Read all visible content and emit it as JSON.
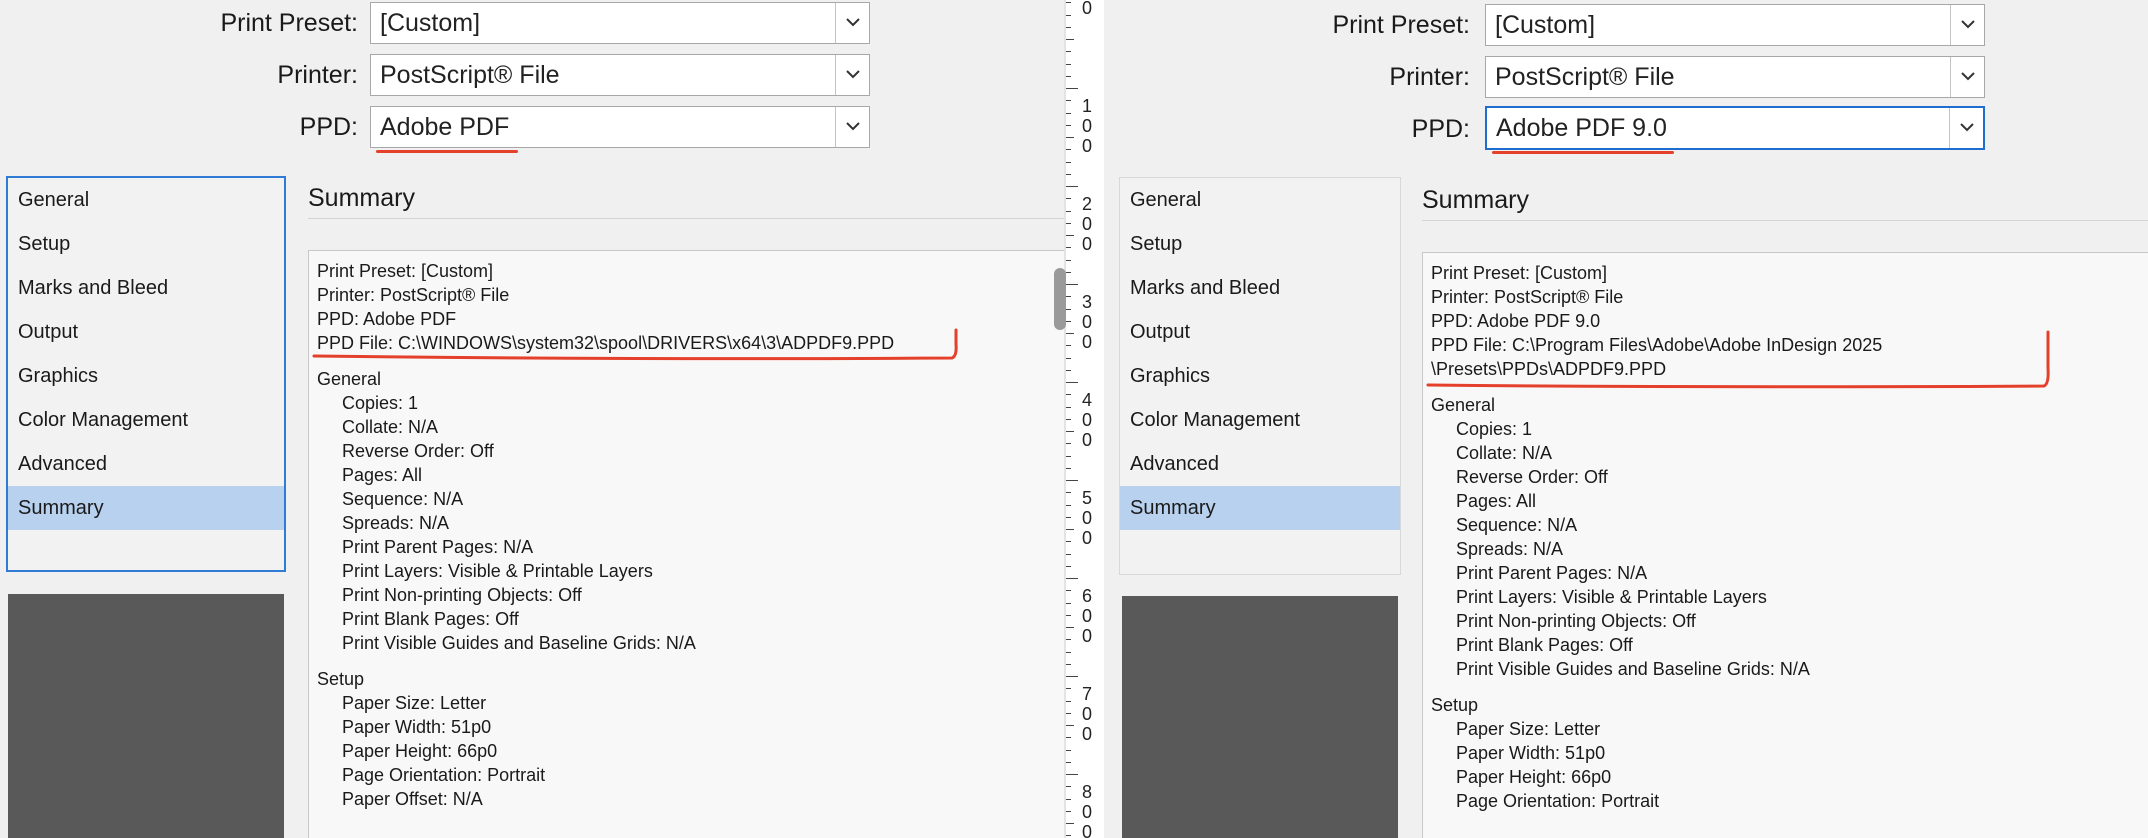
{
  "left": {
    "print_preset_label": "Print Preset:",
    "print_preset_value": "[Custom]",
    "printer_label": "Printer:",
    "printer_value": "PostScript® File",
    "ppd_label": "PPD:",
    "ppd_value": "Adobe PDF",
    "nav": [
      "General",
      "Setup",
      "Marks and Bleed",
      "Output",
      "Graphics",
      "Color Management",
      "Advanced",
      "Summary"
    ],
    "selected_nav": "Summary",
    "summary_title": "Summary",
    "summary": {
      "header": [
        "Print Preset: [Custom]",
        "Printer: PostScript® File",
        "PPD: Adobe PDF"
      ],
      "ppd_file": "PPD File: C:\\WINDOWS\\system32\\spool\\DRIVERS\\x64\\3\\ADPDF9.PPD",
      "general_head": "General",
      "general": [
        "Copies: 1",
        "Collate: N/A",
        "Reverse Order: Off",
        "Pages: All",
        "Sequence: N/A",
        "Spreads: N/A",
        "Print Parent Pages: N/A",
        "Print Layers: Visible & Printable Layers",
        "Print Non-printing Objects: Off",
        "Print Blank Pages: Off",
        "Print Visible Guides and Baseline Grids: N/A"
      ],
      "setup_head": "Setup",
      "setup": [
        "Paper Size: Letter",
        "Paper Width: 51p0",
        "Paper Height: 66p0",
        "Page Orientation: Portrait",
        "Paper Offset: N/A"
      ]
    }
  },
  "right": {
    "print_preset_label": "Print Preset:",
    "print_preset_value": "[Custom]",
    "printer_label": "Printer:",
    "printer_value": "PostScript® File",
    "ppd_label": "PPD:",
    "ppd_value": "Adobe PDF 9.0",
    "nav": [
      "General",
      "Setup",
      "Marks and Bleed",
      "Output",
      "Graphics",
      "Color Management",
      "Advanced",
      "Summary"
    ],
    "selected_nav": "Summary",
    "summary_title": "Summary",
    "summary": {
      "header": [
        "Print Preset: [Custom]",
        "Printer: PostScript® File",
        "PPD: Adobe PDF 9.0"
      ],
      "ppd_file_line1": "PPD File: C:\\Program Files\\Adobe\\Adobe InDesign 2025",
      "ppd_file_line2": "\\Presets\\PPDs\\ADPDF9.PPD",
      "general_head": "General",
      "general": [
        "Copies: 1",
        "Collate: N/A",
        "Reverse Order: Off",
        "Pages: All",
        "Sequence: N/A",
        "Spreads: N/A",
        "Print Parent Pages: N/A",
        "Print Layers: Visible & Printable Layers",
        "Print Non-printing Objects: Off",
        "Print Blank Pages: Off",
        "Print Visible Guides and Baseline Grids: N/A"
      ],
      "setup_head": "Setup",
      "setup": [
        "Paper Size: Letter",
        "Paper Width: 51p0",
        "Paper Height: 66p0",
        "Page Orientation: Portrait"
      ]
    }
  },
  "ruler": [
    "0",
    "1\n0\n0",
    "2\n0\n0",
    "3\n0\n0",
    "4\n0\n0",
    "5\n0\n0",
    "6\n0\n0",
    "7\n0\n0",
    "8\n0\n0"
  ],
  "colors": {
    "selection": "#b8d1ee",
    "annotation_red": "#e5402b",
    "focus_blue": "#1f6ecf",
    "preview_gray": "#595959"
  }
}
